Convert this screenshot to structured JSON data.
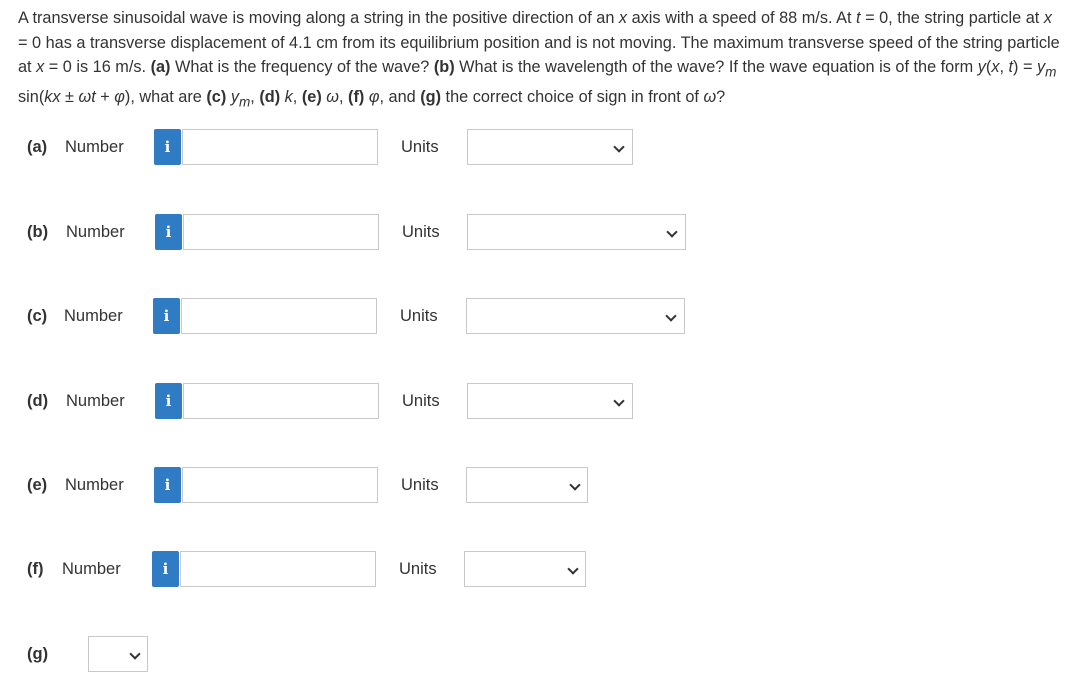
{
  "question": {
    "s1": "A transverse sinusoidal wave is moving along a string in the positive direction of an ",
    "s1_x": "x",
    "s2": " axis with a speed of 88 m/s. At ",
    "s2_t": "t",
    "s3": " = 0, the string particle at ",
    "s3_x": "x",
    "s4": " = 0 has a transverse displacement of 4.1 cm from its equilibrium position and is not moving. The maximum transverse speed of the string particle at ",
    "s4_x": "x",
    "s5": " = 0 is 16 m/s. ",
    "a_tag": "(a)",
    "a_text": " What is the frequency of the wave? ",
    "b_tag": "(b)",
    "b_text": " What is the wavelength of the wave? If the wave equation is of the form ",
    "eq1": "y",
    "eq2": "(",
    "eq3": "x",
    "eq4": ", ",
    "eq5": "t",
    "eq6": ") = ",
    "eq7": "y",
    "eq7_sub": "m",
    "eq8": " sin(",
    "eq9": "kx",
    "eq10": " ± ",
    "eq11": "ωt",
    "eq12": " + ",
    "eq13": "φ",
    "eq14": "), what are ",
    "c_tag": "(c)",
    "c_sp": " ",
    "c_y": "y",
    "c_sub": "m",
    "c_comma": ", ",
    "d_tag": "(d)",
    "d_sp": " ",
    "d_k": "k",
    "d_comma": ", ",
    "e_tag": "(e)",
    "e_sp": " ",
    "e_w": "ω",
    "e_comma": ", ",
    "f_tag": "(f)",
    "f_sp": " ",
    "f_phi": "φ",
    "f_comma": ", and ",
    "g_tag": "(g)",
    "g_text": " the correct choice of sign in front of ",
    "g_w": "ω",
    "g_end": "?"
  },
  "rows": [
    {
      "part": "(a)",
      "number_label": "Number",
      "info": "i",
      "units_label": "Units"
    },
    {
      "part": "(b)",
      "number_label": "Number",
      "info": "i",
      "units_label": "Units"
    },
    {
      "part": "(c)",
      "number_label": "Number",
      "info": "i",
      "units_label": "Units"
    },
    {
      "part": "(d)",
      "number_label": "Number",
      "info": "i",
      "units_label": "Units"
    },
    {
      "part": "(e)",
      "number_label": "Number",
      "info": "i",
      "units_label": "Units"
    },
    {
      "part": "(f)",
      "number_label": "Number",
      "info": "i",
      "units_label": "Units"
    }
  ],
  "g_part": "(g)",
  "colors": {
    "info_button": "#2f7bc4",
    "input_border": "#c9c9c9",
    "text": "#333333"
  },
  "icons": {
    "info": "info-icon",
    "dropdown": "chevron-down-icon"
  }
}
